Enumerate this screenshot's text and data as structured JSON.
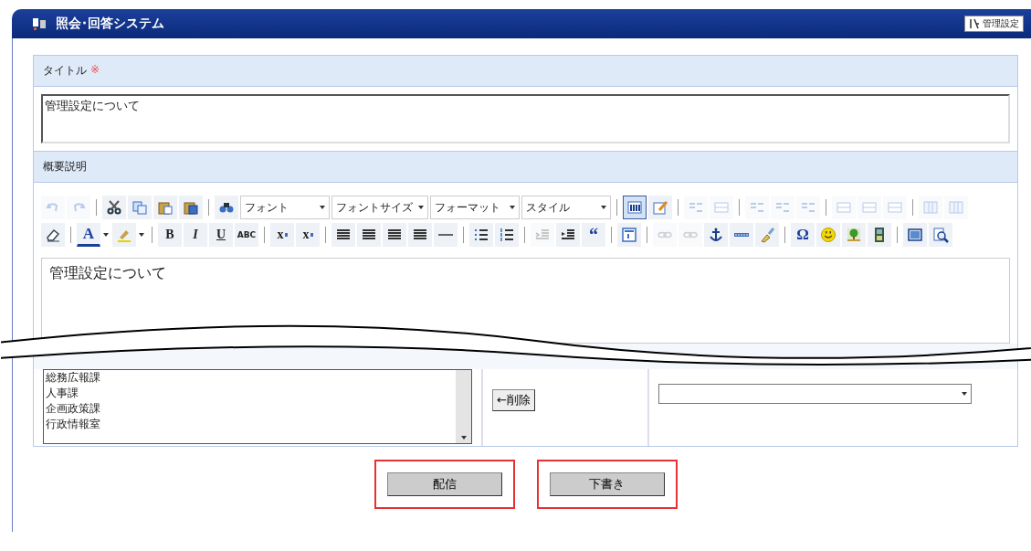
{
  "window": {
    "title": "照会･回答システム",
    "admin_button": "管理設定"
  },
  "title_field": {
    "label": "タイトル",
    "required_mark": "※",
    "value": "管理設定について"
  },
  "description": {
    "label": "概要説明",
    "toolbar_rows": [
      [
        {
          "kind": "undo",
          "disabled": true
        },
        {
          "kind": "redo",
          "disabled": true
        },
        {
          "kind": "sep"
        },
        {
          "kind": "cut",
          "disabled": false
        },
        {
          "kind": "copy",
          "disabled": false
        },
        {
          "kind": "paste",
          "disabled": false
        },
        {
          "kind": "paste-word",
          "disabled": false
        },
        {
          "kind": "sep"
        },
        {
          "kind": "find",
          "disabled": false
        },
        {
          "kind": "select",
          "label": "フォント"
        },
        {
          "kind": "select",
          "label": "フォントサイズ"
        },
        {
          "kind": "select",
          "label": "フォーマット"
        },
        {
          "kind": "select",
          "label": "スタイル"
        },
        {
          "kind": "sep"
        },
        {
          "kind": "source",
          "disabled": false,
          "selected": true
        },
        {
          "kind": "form",
          "disabled": false,
          "selected": false
        },
        {
          "kind": "sep"
        },
        {
          "kind": "row",
          "disabled": true
        },
        {
          "kind": "cell",
          "disabled": true
        },
        {
          "kind": "sep"
        },
        {
          "kind": "row",
          "disabled": true
        },
        {
          "kind": "row",
          "disabled": true
        },
        {
          "kind": "row",
          "disabled": true
        },
        {
          "kind": "sep"
        },
        {
          "kind": "cell",
          "disabled": true
        },
        {
          "kind": "cell",
          "disabled": true
        },
        {
          "kind": "cell",
          "disabled": true
        },
        {
          "kind": "sep"
        },
        {
          "kind": "table",
          "disabled": true
        },
        {
          "kind": "table",
          "disabled": true
        }
      ],
      [
        {
          "kind": "eraser",
          "disabled": false
        },
        {
          "kind": "sep"
        },
        {
          "kind": "color",
          "label": "A",
          "disabled": false
        },
        {
          "kind": "highlight",
          "disabled": false
        },
        {
          "kind": "sep"
        },
        {
          "kind": "bold",
          "label": "B",
          "disabled": false
        },
        {
          "kind": "italic",
          "label": "I",
          "disabled": false
        },
        {
          "kind": "underline",
          "label": "U",
          "disabled": false
        },
        {
          "kind": "strike",
          "label": "ABC",
          "disabled": false
        },
        {
          "kind": "sep"
        },
        {
          "kind": "subscript",
          "label": "x",
          "disabled": false
        },
        {
          "kind": "superscript",
          "label": "x",
          "disabled": false
        },
        {
          "kind": "sep"
        },
        {
          "kind": "align",
          "disabled": false
        },
        {
          "kind": "align",
          "disabled": false
        },
        {
          "kind": "align",
          "disabled": false
        },
        {
          "kind": "align",
          "disabled": false
        },
        {
          "kind": "hr",
          "disabled": false
        },
        {
          "kind": "sep"
        },
        {
          "kind": "bullets",
          "disabled": false
        },
        {
          "kind": "numbers",
          "disabled": false
        },
        {
          "kind": "sep"
        },
        {
          "kind": "outdent",
          "disabled": true
        },
        {
          "kind": "indent",
          "disabled": false
        },
        {
          "kind": "quote",
          "label": "“",
          "disabled": false
        },
        {
          "kind": "sep"
        },
        {
          "kind": "div",
          "disabled": false
        },
        {
          "kind": "sep"
        },
        {
          "kind": "link",
          "disabled": true
        },
        {
          "kind": "link",
          "disabled": true
        },
        {
          "kind": "anchor",
          "disabled": false
        },
        {
          "kind": "html",
          "disabled": false
        },
        {
          "kind": "brush",
          "disabled": false
        },
        {
          "kind": "sep"
        },
        {
          "kind": "omega",
          "label": "Ω",
          "disabled": false
        },
        {
          "kind": "smiley",
          "disabled": false
        },
        {
          "kind": "image",
          "disabled": false
        },
        {
          "kind": "film",
          "disabled": false
        },
        {
          "kind": "sep"
        },
        {
          "kind": "screen",
          "disabled": false
        },
        {
          "kind": "preview",
          "disabled": false
        }
      ]
    ],
    "body": "管理設定について"
  },
  "departments": {
    "items": [
      "総務広報課",
      "人事課",
      "企画政策課",
      "行政情報室"
    ]
  },
  "remove_button": "←削除",
  "buttons": [
    {
      "label": "配信",
      "highlighted": true
    },
    {
      "label": "下書き",
      "highlighted": true
    }
  ]
}
